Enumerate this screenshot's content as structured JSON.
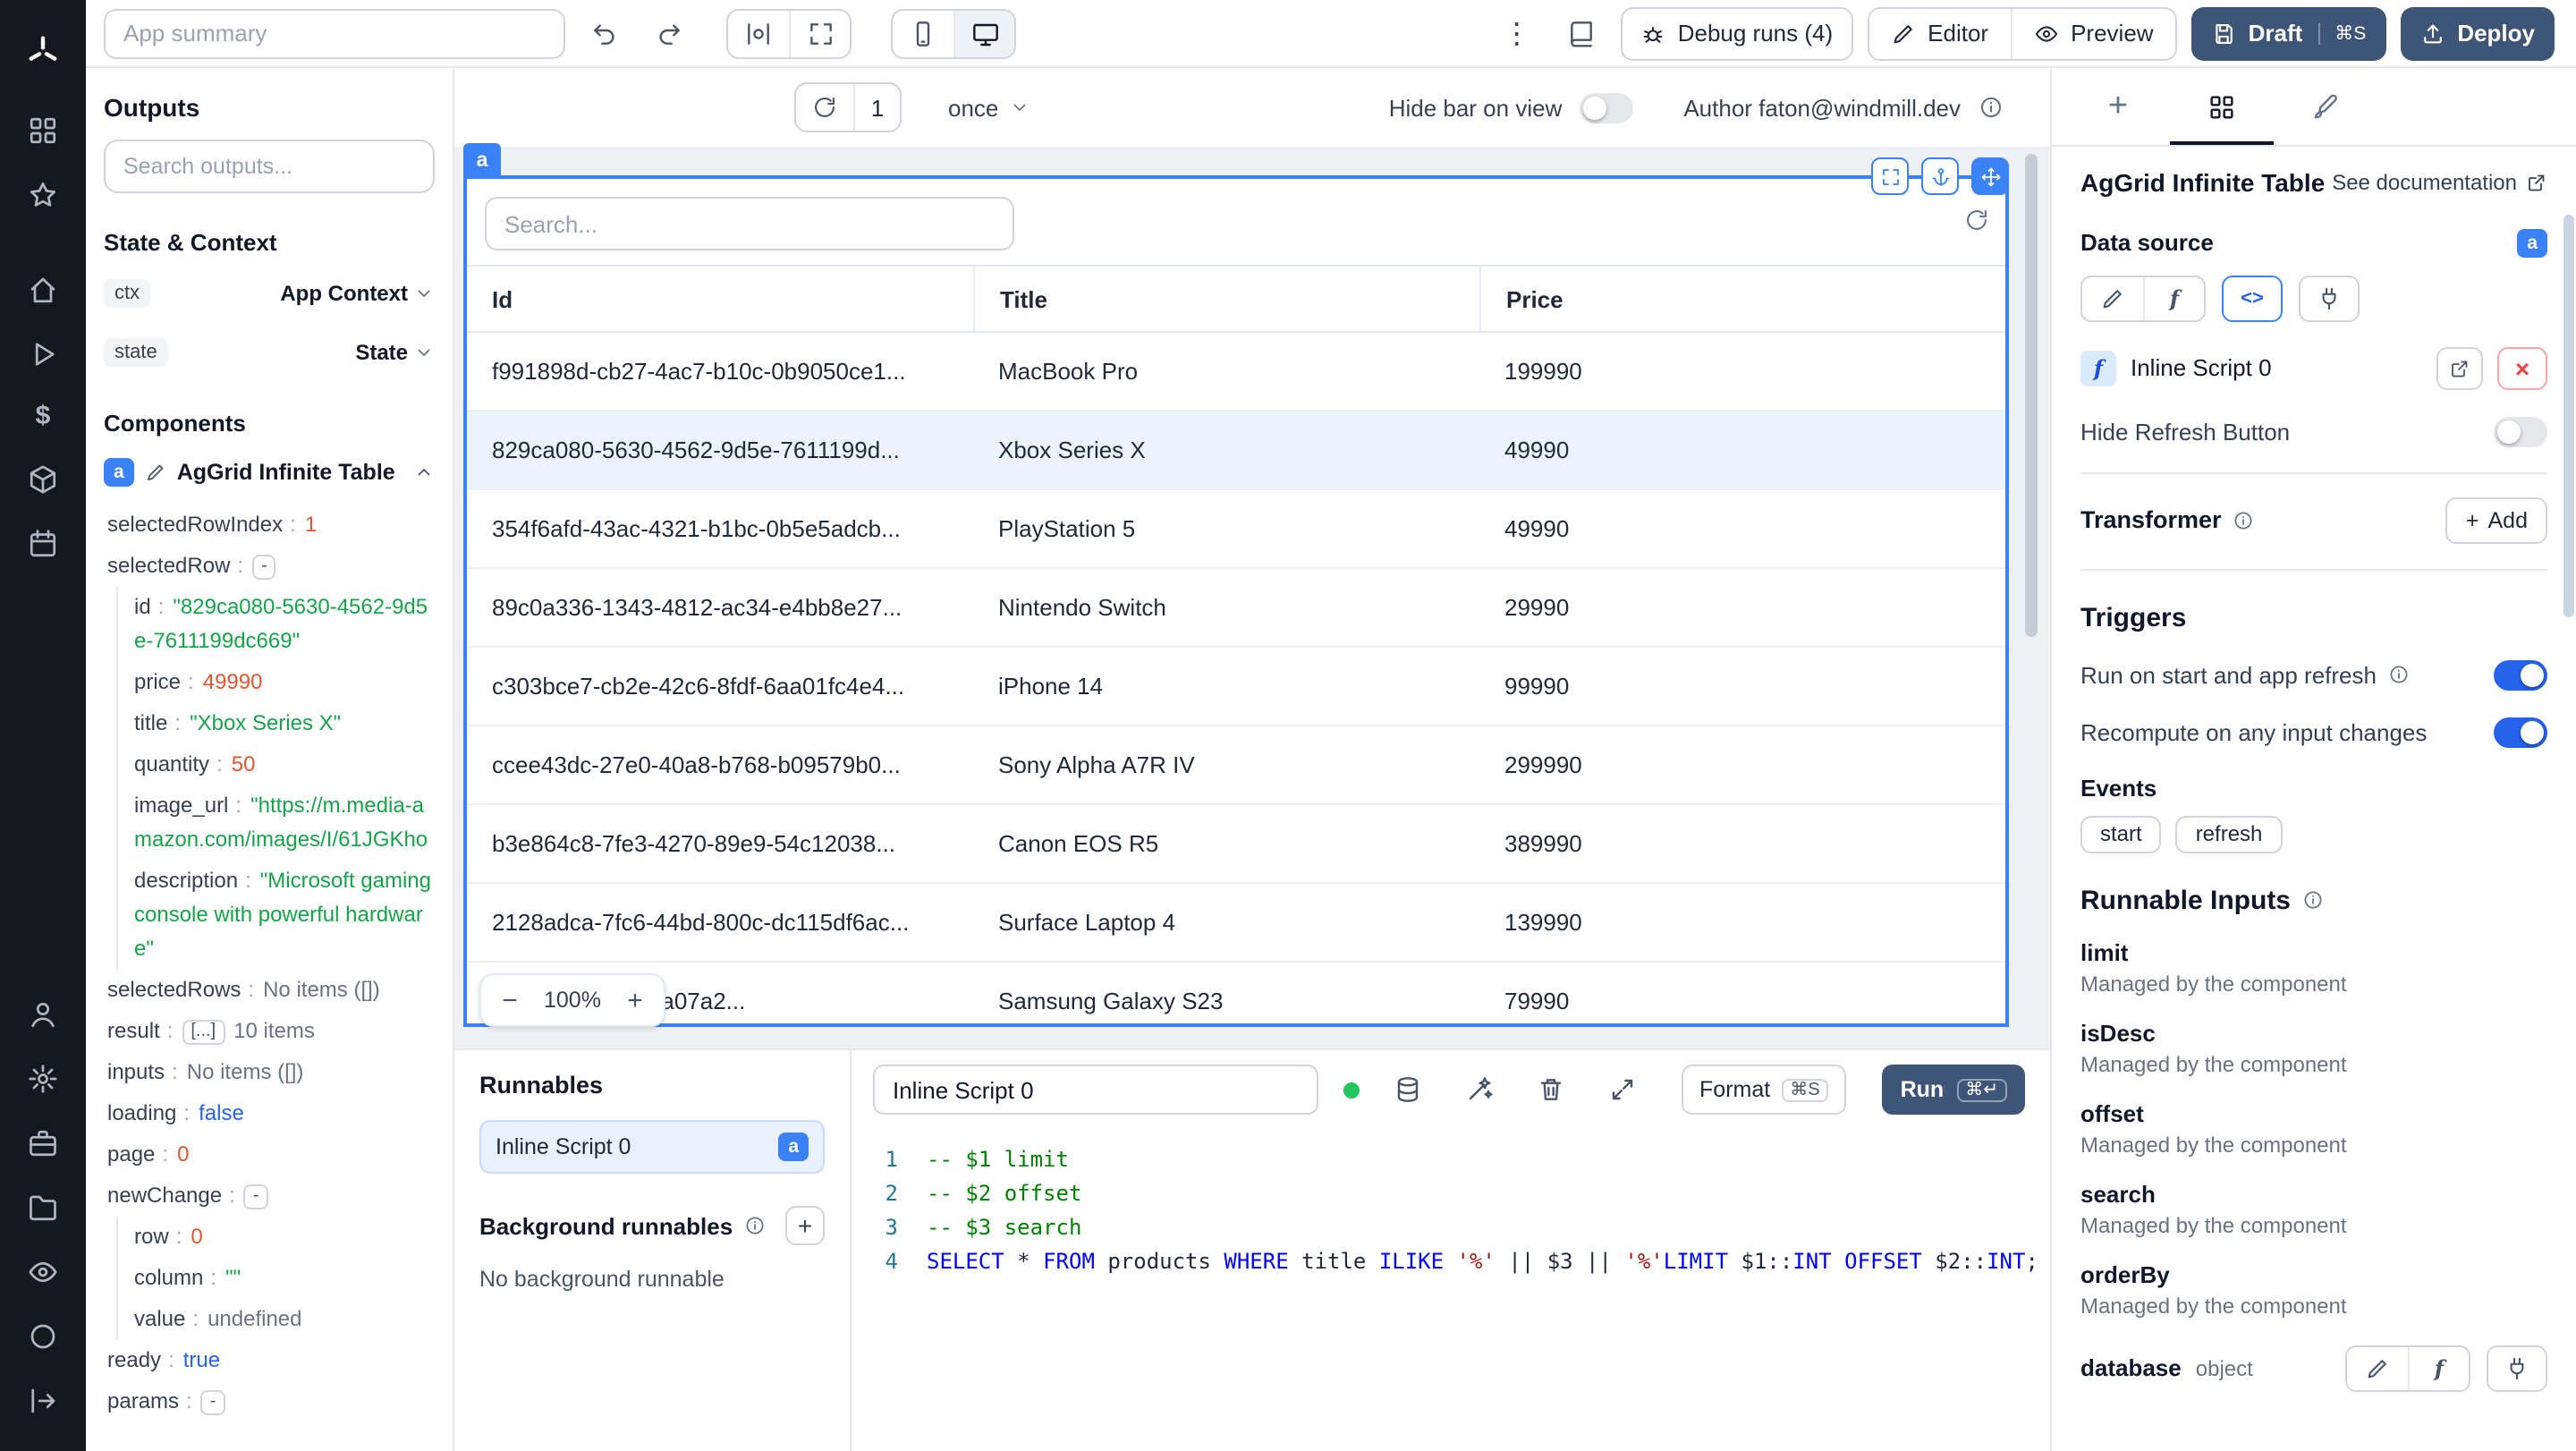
{
  "topbar": {
    "summary_placeholder": "App summary",
    "debug_runs_label": "Debug runs (4)",
    "editor_label": "Editor",
    "preview_label": "Preview",
    "draft_label": "Draft",
    "draft_shortcut": "⌘S",
    "deploy_label": "Deploy"
  },
  "outputs": {
    "title": "Outputs",
    "search_placeholder": "Search outputs...",
    "state_context_title": "State & Context",
    "ctx_key": "ctx",
    "ctx_value": "App Context",
    "state_key": "state",
    "state_value": "State",
    "components_title": "Components",
    "component_badge": "a",
    "component_name": "AgGrid Infinite Table",
    "tree": [
      {
        "key": "selectedRowIndex",
        "value": "1"
      },
      {
        "key": "selectedRow",
        "value": "-"
      },
      {
        "key": "id",
        "value": "\"829ca080-5630-4562-9d5e-7611199dc669\""
      },
      {
        "key": "price",
        "value": "49990"
      },
      {
        "key": "title",
        "value": "\"Xbox Series X\""
      },
      {
        "key": "quantity",
        "value": "50"
      },
      {
        "key": "image_url",
        "value": "\"https://m.media-amazon.com/images/I/61JGKho"
      },
      {
        "key": "description",
        "value": "\"Microsoft gaming console with powerful hardware\""
      },
      {
        "key": "selectedRows",
        "value": "No items ([])"
      },
      {
        "key": "result",
        "value": "[...]",
        "extra": "10 items"
      },
      {
        "key": "inputs",
        "value": "No items ([])"
      },
      {
        "key": "loading",
        "value": "false"
      },
      {
        "key": "page",
        "value": "0"
      },
      {
        "key": "newChange",
        "value": "-"
      },
      {
        "key": "row",
        "value": "0"
      },
      {
        "key": "column",
        "value": "\"\""
      },
      {
        "key": "value",
        "value": "undefined"
      },
      {
        "key": "ready",
        "value": "true"
      },
      {
        "key": "params",
        "value": "-"
      }
    ]
  },
  "canvas": {
    "refresh_count": "1",
    "interval_label": "once",
    "hide_bar_label": "Hide bar on view",
    "author_label": "Author faton@windmill.dev",
    "component_tag": "a",
    "zoom_minus": "−",
    "zoom_value": "100%",
    "zoom_plus": "+"
  },
  "table": {
    "search_placeholder": "Search...",
    "columns": [
      "Id",
      "Title",
      "Price"
    ],
    "rows": [
      {
        "id": "f991898d-cb27-4ac7-b10c-0b9050ce1...",
        "title": "MacBook Pro",
        "price": "199990"
      },
      {
        "id": "829ca080-5630-4562-9d5e-7611199d...",
        "title": "Xbox Series X",
        "price": "49990"
      },
      {
        "id": "354f6afd-43ac-4321-b1bc-0b5e5adcb...",
        "title": "PlayStation 5",
        "price": "49990"
      },
      {
        "id": "89c0a336-1343-4812-ac34-e4bb8e27...",
        "title": "Nintendo Switch",
        "price": "29990"
      },
      {
        "id": "c303bce7-cb2e-42c6-8fdf-6aa01fc4e4...",
        "title": "iPhone 14",
        "price": "99990"
      },
      {
        "id": "ccee43dc-27e0-40a8-b768-b09579b0...",
        "title": "Sony Alpha A7R IV",
        "price": "299990"
      },
      {
        "id": "b3e864c8-7fe3-4270-89e9-54c12038...",
        "title": "Canon EOS R5",
        "price": "389990"
      },
      {
        "id": "2128adca-7fc6-44bd-800c-dc115df6ac...",
        "title": "Surface Laptop 4",
        "price": "139990"
      },
      {
        "id": "4c83-8022-5e70a07a2...",
        "title": "Samsung Galaxy S23",
        "price": "79990"
      }
    ]
  },
  "runnables": {
    "title": "Runnables",
    "item_label": "Inline Script 0",
    "item_badge": "a",
    "background_title": "Background runnables",
    "background_empty": "No background runnable"
  },
  "editor": {
    "name_value": "Inline Script 0",
    "format_label": "Format",
    "format_shortcut": "⌘S",
    "run_label": "Run",
    "run_shortcut": "⌘↵",
    "line_numbers": [
      "1",
      "2",
      "3",
      "4"
    ],
    "code": {
      "l1": "-- $1 limit",
      "l2": "-- $2 offset",
      "l3": "-- $3 search",
      "l4": [
        {
          "c": "kw",
          "t": "SELECT"
        },
        {
          "c": "pl",
          "t": " * "
        },
        {
          "c": "kw",
          "t": "FROM"
        },
        {
          "c": "pl",
          "t": " products "
        },
        {
          "c": "kw",
          "t": "WHERE"
        },
        {
          "c": "pl",
          "t": " title "
        },
        {
          "c": "kw",
          "t": "ILIKE"
        },
        {
          "c": "pl",
          "t": " "
        },
        {
          "c": "str",
          "t": "'%'"
        },
        {
          "c": "pl",
          "t": " || $3 || "
        },
        {
          "c": "str",
          "t": "'%'"
        },
        {
          "c": "kw",
          "t": "LIMIT"
        },
        {
          "c": "pl",
          "t": " $1::"
        },
        {
          "c": "kw",
          "t": "INT"
        },
        {
          "c": "pl",
          "t": " "
        },
        {
          "c": "kw",
          "t": "OFFSET"
        },
        {
          "c": "pl",
          "t": " $2::"
        },
        {
          "c": "kw",
          "t": "INT"
        },
        {
          "c": "pl",
          "t": ";"
        }
      ]
    }
  },
  "settings": {
    "title": "AgGrid Infinite Table",
    "doc_label": "See documentation",
    "data_source_label": "Data source",
    "data_source_badge": "a",
    "code_icon_label": "<>",
    "f_icon_label": "f",
    "script_name": "Inline Script 0",
    "hide_refresh_label": "Hide Refresh Button",
    "transformer_label": "Transformer",
    "add_label": "Add",
    "triggers_title": "Triggers",
    "trigger_run_label": "Run on start and app refresh",
    "trigger_recompute_label": "Recompute on any input changes",
    "events_label": "Events",
    "events": [
      "start",
      "refresh"
    ],
    "runnable_inputs_title": "Runnable Inputs",
    "managed_text": "Managed by the component",
    "inputs": [
      {
        "name": "limit"
      },
      {
        "name": "isDesc"
      },
      {
        "name": "offset"
      },
      {
        "name": "search"
      },
      {
        "name": "orderBy"
      }
    ],
    "database_label": "database",
    "database_type": "object"
  }
}
